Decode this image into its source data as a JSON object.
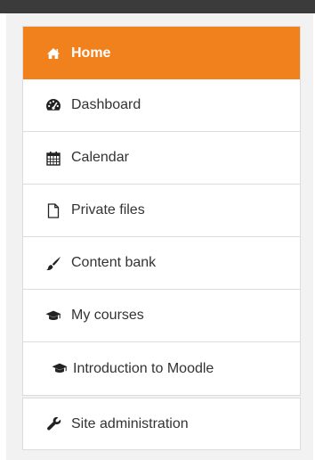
{
  "colors": {
    "accent": "#f0811c",
    "text": "#333333",
    "border": "#dcdcdc",
    "panel_bg": "#f2f2f2",
    "top_bar": "#3b3b3b"
  },
  "nav": {
    "items": [
      {
        "label": "Home",
        "icon": "home-icon",
        "active": true
      },
      {
        "label": "Dashboard",
        "icon": "dashboard-icon"
      },
      {
        "label": "Calendar",
        "icon": "calendar-icon"
      },
      {
        "label": "Private files",
        "icon": "file-icon"
      },
      {
        "label": "Content bank",
        "icon": "paint-brush-icon"
      },
      {
        "label": "My courses",
        "icon": "graduation-cap-icon"
      },
      {
        "label": "Introduction to Moodle",
        "icon": "graduation-cap-icon",
        "indent": true
      }
    ]
  },
  "admin": {
    "label": "Site administration",
    "icon": "wrench-icon"
  }
}
